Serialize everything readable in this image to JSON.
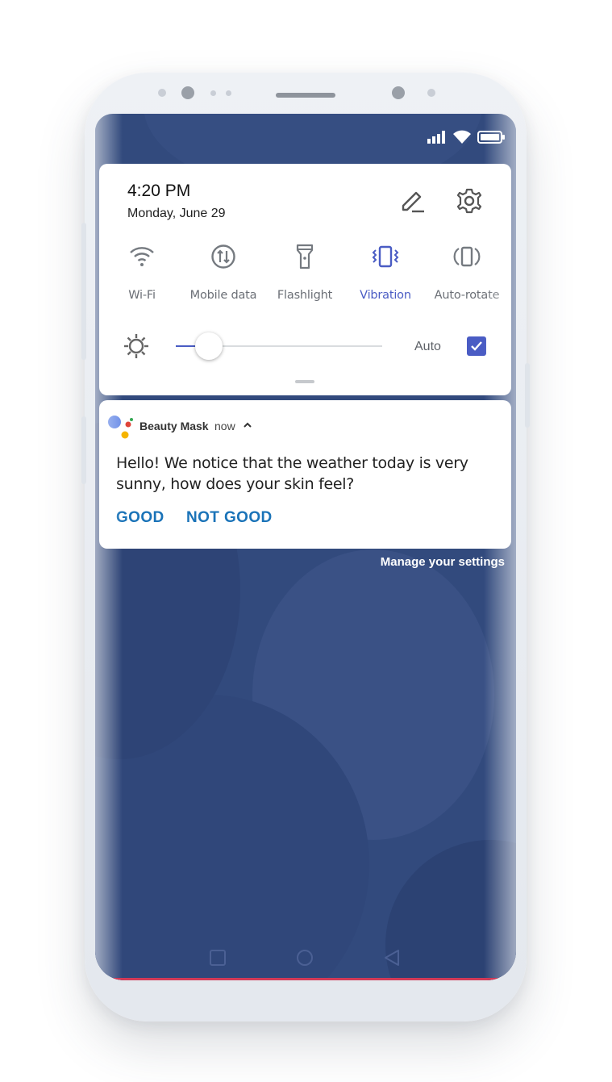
{
  "status_bar": {
    "icons": [
      "signal-icon",
      "wifi-icon",
      "battery-icon"
    ]
  },
  "quick_settings": {
    "time": "4:20 PM",
    "date": "Monday, June 29",
    "tiles": [
      {
        "label": "Wi-Fi",
        "icon": "wifi-icon",
        "active": false
      },
      {
        "label": "Mobile data",
        "icon": "mobile-data-icon",
        "active": false
      },
      {
        "label": "Flashlight",
        "icon": "flashlight-icon",
        "active": false
      },
      {
        "label": "Vibration",
        "icon": "vibration-icon",
        "active": true
      },
      {
        "label": "Auto-rotate",
        "icon": "auto-rotate-icon",
        "active": false
      }
    ],
    "brightness": {
      "level": 0.16,
      "auto_label": "Auto",
      "auto_checked": true
    }
  },
  "notification": {
    "app_name": "Beauty Mask",
    "time": "now",
    "message": "Hello! We notice that the weather today is very sunny, how does your skin feel?",
    "actions": [
      "GOOD",
      "NOT GOOD"
    ]
  },
  "manage_settings": "Manage your settings",
  "colors": {
    "accent": "#4a5cc4",
    "action": "#1a73b8",
    "wallpaper": "#324a7d"
  }
}
